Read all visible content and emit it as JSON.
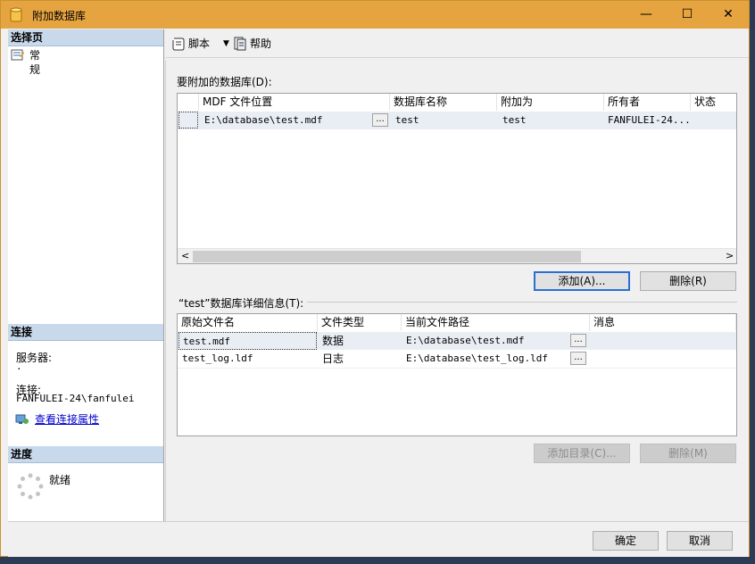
{
  "window": {
    "title": "附加数据库",
    "controls": {
      "minimize": "—",
      "maximize": "☐",
      "close": "✕"
    }
  },
  "left_pane": {
    "select_page_header": "选择页",
    "pages": [
      "常规"
    ],
    "connection_header": "连接",
    "server_label": "服务器:",
    "server_value": ".",
    "connection_label": "连接:",
    "connection_value": "FANFULEI-24\\fanfulei",
    "view_props_link": "查看连接属性",
    "progress_header": "进度",
    "progress_status": "就绪"
  },
  "toolbar": {
    "script": "脚本",
    "help": "帮助"
  },
  "attach": {
    "label": "要附加的数据库(D):",
    "columns": [
      "MDF 文件位置",
      "数据库名称",
      "附加为",
      "所有者",
      "状态"
    ],
    "rows": [
      {
        "mdf": "E:\\database\\test.mdf",
        "ellipsis": "...",
        "name": "test",
        "attach_as": "test",
        "owner": "FANFULEI-24...",
        "status": ""
      }
    ],
    "add_button": "添加(A)...",
    "remove_button": "删除(R)"
  },
  "details": {
    "label": "“test”数据库详细信息(T):",
    "columns": [
      "原始文件名",
      "文件类型",
      "当前文件路径",
      "消息"
    ],
    "rows": [
      {
        "file": "test.mdf",
        "type": "数据",
        "path": "E:\\database\\test.mdf",
        "ellipsis": "...",
        "message": ""
      },
      {
        "file": "test_log.ldf",
        "type": "日志",
        "path": "E:\\database\\test_log.ldf",
        "ellipsis": "...",
        "message": ""
      }
    ],
    "add_catalog_button": "添加目录(C)...",
    "remove_button": "删除(M)"
  },
  "footer": {
    "ok": "确定",
    "cancel": "取消"
  },
  "colors": {
    "titlebar": "#e6a441",
    "section_header": "#c9d9ec",
    "focus": "#2a6fd1"
  },
  "icons": {
    "app": "database-icon",
    "page": "page-icon",
    "script": "script-icon",
    "help": "help-icon",
    "link": "connection-properties-icon",
    "progress": "spinner-icon"
  }
}
